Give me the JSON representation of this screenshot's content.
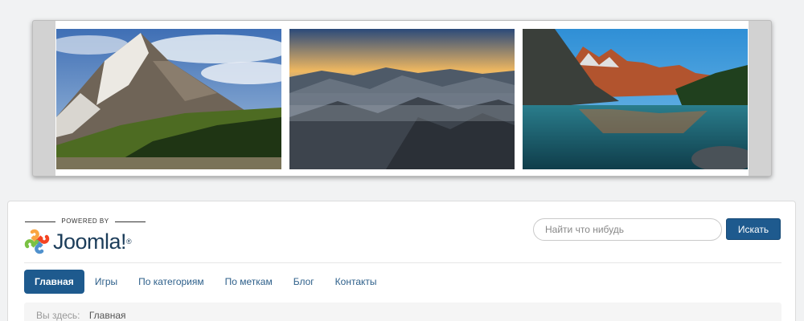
{
  "slider": {
    "slides": [
      {
        "scene": "mountain-peak-forest"
      },
      {
        "scene": "misty-mountains-sunset"
      },
      {
        "scene": "mountain-lake"
      }
    ]
  },
  "header": {
    "powered_by": "POWERED BY",
    "logo_text": "Joomla!",
    "logo_reg": "®",
    "logo_icon": "joomla-logo-icon",
    "colors": {
      "brand_blue": "#1e5a8e",
      "logo_text": "#1c3d5a"
    }
  },
  "search": {
    "placeholder": "Найти что нибудь",
    "button_label": "Искать"
  },
  "nav": {
    "items": [
      {
        "label": "Главная",
        "active": true
      },
      {
        "label": "Игры"
      },
      {
        "label": "По категориям"
      },
      {
        "label": "По меткам"
      },
      {
        "label": "Блог"
      },
      {
        "label": "Контакты"
      }
    ]
  },
  "breadcrumb": {
    "label": "Вы здесь:",
    "current": "Главная"
  }
}
